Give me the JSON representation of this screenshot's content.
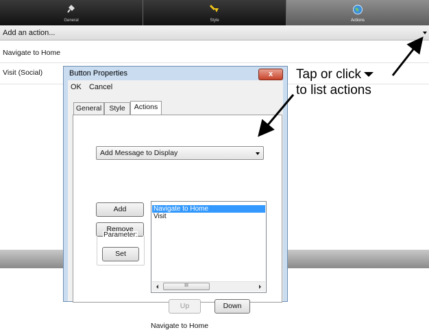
{
  "top_tabs": [
    {
      "label": "General",
      "icon": "paint-bucket-icon",
      "active": false
    },
    {
      "label": "Style",
      "icon": "brush-icon",
      "active": false
    },
    {
      "label": "Actions",
      "icon": "globe-icon",
      "active": true
    }
  ],
  "action_bar": {
    "value": "Add an action..."
  },
  "actions_list": [
    {
      "label": "Navigate to Home"
    },
    {
      "label": "Visit (Social)"
    }
  ],
  "dialog": {
    "title": "Button Properties",
    "close_label": "x",
    "menu": {
      "ok": "OK",
      "cancel": "Cancel"
    },
    "tabs": [
      {
        "label": "General"
      },
      {
        "label": "Style"
      },
      {
        "label": "Actions"
      }
    ],
    "select_value": "Add Message to Display",
    "add_label": "Add",
    "remove_label": "Remove",
    "parameter_label": "Parameter:",
    "set_label": "Set",
    "list_items": [
      "Navigate to Home",
      "Visit"
    ],
    "scroll_thumb": "III",
    "up_label": "Up",
    "down_label": "Down",
    "status_text": "Navigate to Home"
  },
  "annotation": {
    "line1": "Tap or click",
    "line2": "to list actions"
  },
  "colors": {
    "selection": "#3399ff",
    "dialog_frame": "#c9dcf0",
    "close_button": "#c7432a"
  }
}
